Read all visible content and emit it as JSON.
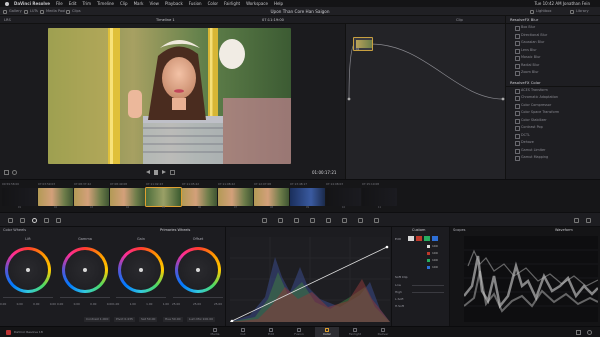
{
  "menubar": {
    "app_name": "DaVinci Resolve",
    "items": [
      "File",
      "Edit",
      "Trim",
      "Timeline",
      "Clip",
      "Mark",
      "View",
      "Playback",
      "Fusion",
      "Color",
      "Fairlight",
      "Workspace",
      "Help"
    ],
    "right_text": "Tue 10:42 AM  Jonathan Fein"
  },
  "header": {
    "project_title": "Upon Than Core Han Saigon",
    "left_items": [
      "Gallery",
      "LUTs",
      "Media Pool",
      "Clips"
    ],
    "right_items": [
      "Lightbox",
      "Library"
    ],
    "toolbar2_left": "LRS",
    "timeline_name": "Timeline 1",
    "timecode_top": "07:11:19:00",
    "clip_label": "Clip",
    "tab_library": "Library",
    "tab_settings": "Settings"
  },
  "viewer": {
    "timecode": "01:00:17:21"
  },
  "node": {
    "label": "01"
  },
  "library": {
    "sections": [
      {
        "title": "ResolveFX Blur",
        "items": [
          "Box Blur",
          "Directional Blur",
          "Gaussian Blur",
          "Lens Blur",
          "Mosaic Blur",
          "Radial Blur",
          "Zoom Blur"
        ]
      },
      {
        "title": "ResolveFX Color",
        "items": [
          "ACES Transform",
          "Chromatic Adaptation",
          "Color Compressor",
          "Color Space Transform",
          "Color Stabilizer",
          "Contrast Pop",
          "DCTL",
          "Dehaze",
          "Gamut Limiter",
          "Gamut Mapping"
        ]
      }
    ]
  },
  "clips": [
    {
      "tc": "00:59:58:00",
      "num": "01",
      "tone": "dark"
    },
    {
      "tc": "07:03:59:03",
      "num": "02",
      "tone": "warm"
    },
    {
      "tc": "07:08:37:22",
      "num": "03",
      "tone": "warm"
    },
    {
      "tc": "07:08:49:08",
      "num": "04",
      "tone": "warm"
    },
    {
      "tc": "07:11:02:23",
      "num": "05",
      "tone": "green"
    },
    {
      "tc": "07:11:05:22",
      "num": "06",
      "tone": "warm"
    },
    {
      "tc": "07:11:08:22",
      "num": "07",
      "tone": "warm"
    },
    {
      "tc": "07:12:07:08",
      "num": "08",
      "tone": "warm"
    },
    {
      "tc": "07:13:48:17",
      "num": "09",
      "tone": "blue"
    },
    {
      "tc": "07:14:08:03",
      "num": "10",
      "tone": "dark"
    },
    {
      "tc": "07:15:10:08",
      "num": "11",
      "tone": "dark"
    }
  ],
  "color": {
    "panel_title": "Color Wheels",
    "mode_title": "Primaries Wheels",
    "wheels": [
      {
        "label": "Lift",
        "vals": [
          "0.00",
          "0.00",
          "0.00",
          "0.00"
        ]
      },
      {
        "label": "Gamma",
        "vals": [
          "0.00",
          "0.00",
          "0.00",
          "0.00"
        ]
      },
      {
        "label": "Gain",
        "vals": [
          "1.00",
          "1.00",
          "1.00",
          "1.00"
        ]
      },
      {
        "label": "Offset",
        "vals": [
          "25.00",
          "25.00",
          "25.00"
        ]
      }
    ],
    "bottom_params": [
      "Contrast 1.000",
      "Pivot 0.435",
      "Sat 50.00",
      "Hue 50.00",
      "Lum Mix 100.00"
    ]
  },
  "curves": {
    "title": "Curves",
    "panel2_title": "Custom",
    "edit_label": "Edit",
    "soft_clip": "Soft Clip",
    "rows": [
      "Low",
      "High",
      "L.Soft",
      "H.Soft"
    ],
    "values": [
      "100",
      "100",
      "100",
      "100"
    ]
  },
  "scope": {
    "title": "Scopes",
    "mode": "Waveform"
  },
  "pages": [
    "Media",
    "Cut",
    "Edit",
    "Fusion",
    "Color",
    "Fairlight",
    "Deliver"
  ],
  "active_page": "Color",
  "footer": {
    "app_label": "DaVinci Resolve 18"
  }
}
